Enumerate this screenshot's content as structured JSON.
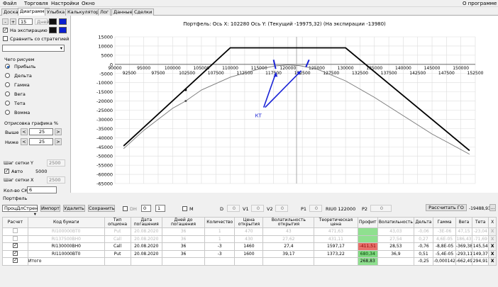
{
  "menu": [
    "Файл",
    "Торговля",
    "Настройки",
    "Окно"
  ],
  "menu_right": "О программе",
  "tabs": [
    "Доска",
    "Диаграмма",
    "Улыбка",
    "Калькулятор",
    "Лог",
    "Данные",
    "Сделки"
  ],
  "left": {
    "minus": "-",
    "plus": "+",
    "days_value": "15",
    "days_label": "Дней",
    "at_expiry": "На экспирацию",
    "compare": "Сравнить со стратегией",
    "what_to_draw": "Чего рисуем",
    "radios": [
      "Прибыль",
      "Дельта",
      "Гамма",
      "Вега",
      "Тета",
      "Вомма"
    ],
    "render_pct": "Отрисовка графика %",
    "above_label": "Выше",
    "above_value": "25",
    "below_label": "Ниже",
    "below_value": "25",
    "grid_y": "Шаг сетки Y",
    "grid_y_value": "2500",
    "auto": "Авто",
    "auto_value": "5000",
    "grid_x": "Шаг сетки X",
    "grid_x_value": "2500",
    "sko": "Кол-во СКО",
    "sko_value": "6"
  },
  "chart_data": {
    "type": "line",
    "title": "Портфель: Ось X: 102280 Ось Y:  (Текущий -19975,32)  (На экспирации -13980)",
    "xlim": [
      90000,
      152500
    ],
    "ylim": [
      -65000,
      15000
    ],
    "x_ticks_top": [
      "90000",
      "95000",
      "100000",
      "105000",
      "110000",
      "115000",
      "120000",
      "125000",
      "130000",
      "135000",
      "140000",
      "145000",
      "150000"
    ],
    "x_ticks_bottom": [
      "92500",
      "97500",
      "102500",
      "107500",
      "112500",
      "117500",
      "122500",
      "127500",
      "132500",
      "137500",
      "142500",
      "147500",
      "152500"
    ],
    "y_ticks": [
      "15000",
      "10000",
      "5000",
      "0",
      "-5000",
      "-10000",
      "-15000",
      "-20000",
      "-25000",
      "-30000",
      "-35000",
      "-40000",
      "-45000",
      "-50000",
      "-55000",
      "-60000",
      "-65000"
    ],
    "series": [
      {
        "x": [
          91500,
          110000,
          130000,
          151500
        ],
        "y": [
          -44500,
          9000,
          9000,
          -47000
        ]
      },
      {
        "x": [
          91500,
          95000,
          100000,
          102280,
          105000,
          110000,
          115000,
          118000,
          120000,
          122000,
          125000,
          130000,
          135000,
          140000,
          145000,
          151500
        ],
        "y": [
          -46000,
          -36000,
          -24000,
          -19975,
          -14000,
          -7000,
          -2500,
          -800,
          -300,
          -700,
          -2500,
          -9000,
          -18000,
          -28000,
          -38000,
          -49000
        ]
      }
    ],
    "annotation": "КТ",
    "current_x": 121500
  },
  "portfolio": {
    "header": "Портфель",
    "account": "ПроцДлСтрен",
    "btn_import": "Импорт",
    "btn_delete": "Удалить",
    "btn_save": "Сохранить",
    "dh": "DH",
    "dh_v1": "0",
    "dh_v2": "1",
    "m": "M",
    "d": "D",
    "d_val": "0",
    "v1": "V1",
    "v1_val": "0",
    "v2": "V2",
    "v2_val": "0",
    "p1": "P1",
    "p1_val": "0",
    "ri": "RIU0 122000",
    "p2": "P2",
    "p2_val": "0",
    "calc_btn": "Рассчитать ГО",
    "go_value": "-19488,93",
    "go_btn": "..."
  },
  "table": {
    "headers": [
      "Расчет",
      "Код бумаги",
      "Тип опциона",
      "Дата погашения",
      "Дней до погашения",
      "Количество",
      "Цена открытия",
      "Волатильность открытия",
      "Теоретическая цена",
      "Профит",
      "Волатильность",
      "Дельта",
      "Гамма",
      "Вега",
      "Тета",
      "Х"
    ],
    "rows": [
      {
        "checked": false,
        "cells": [
          "RI100000BT0",
          "Put",
          "20.08.2020",
          "36",
          "1",
          "470",
          "43",
          "471,63",
          "",
          "43,03",
          "-0,06",
          "-3E-06",
          "47,15",
          "-23,04"
        ],
        "faded": true
      },
      {
        "checked": false,
        "cells": [
          "RI137500BH0",
          "Call",
          "20.08.2020",
          "36",
          "1",
          "430",
          "27,62",
          "431,11",
          "",
          "27,54",
          "0,27",
          "4,6E-05",
          "186,43",
          "-71,69"
        ],
        "faded": true
      },
      {
        "checked": true,
        "cells": [
          "RI130000BH0",
          "Call",
          "20.08.2020",
          "36",
          "-3",
          "1460",
          "27,4",
          "1597,17",
          "-411,51",
          "28,53",
          "-0,76",
          "-8,8E-05",
          "-369,38",
          "145,54"
        ],
        "faded": false,
        "profit": "neg"
      },
      {
        "checked": true,
        "cells": [
          "RI110000BT0",
          "Put",
          "20.08.2020",
          "36",
          "-3",
          "1600",
          "39,17",
          "1373,22",
          "680,34",
          "36,9",
          "0,51",
          "-5,4E-05",
          "-293,11",
          "149,37"
        ],
        "faded": false,
        "profit": "pos"
      },
      {
        "checked": true,
        "cells": [
          "Итого",
          "",
          "",
          "",
          "",
          "",
          "",
          "",
          "268,83",
          "",
          "-0,25",
          "-0,000142",
          "-662,49",
          "294,91"
        ],
        "faded": false,
        "profit": "pos"
      }
    ],
    "x": "X"
  }
}
